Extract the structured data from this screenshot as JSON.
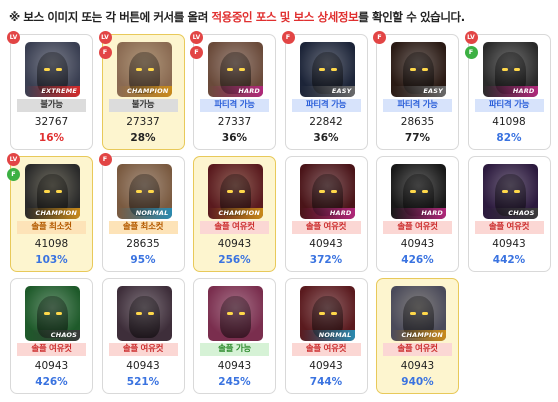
{
  "notice": {
    "prefix": "※ 보스 이미지 또는 각 버튼에 커서를 올려 ",
    "highlight": "적용중인 포스 및 보스 상세정보",
    "suffix": "를 확인할 수 있습니다."
  },
  "colors": {
    "status_gray": "#dcdcdc",
    "status_blue": "#d7e3fb",
    "status_orange": "#fde3b8",
    "status_pink": "#fbd7d4",
    "status_green": "#d6f2d6",
    "highlight_red": "#e03030",
    "card_gold": "#fdf5cf"
  },
  "bosses": [
    {
      "difficulty": "EXTREME",
      "status": "불가능",
      "power": "32767",
      "percent": "16%",
      "badges": [
        "lv"
      ],
      "status_style": "gray",
      "percent_style": "red",
      "highlight": false,
      "theme": "#3a3f52"
    },
    {
      "difficulty": "CHAMPION",
      "status": "불가능",
      "power": "27337",
      "percent": "28%",
      "badges": [
        "lv",
        "f"
      ],
      "status_style": "gray",
      "percent_style": "dark",
      "highlight": true,
      "theme": "#8a6a52"
    },
    {
      "difficulty": "HARD",
      "status": "파티격 가능",
      "power": "27337",
      "percent": "36%",
      "badges": [
        "lv",
        "f"
      ],
      "status_style": "blue",
      "percent_style": "dark",
      "highlight": false,
      "theme": "#6a4a3a"
    },
    {
      "difficulty": "EASY",
      "status": "파티격 가능",
      "power": "22842",
      "percent": "36%",
      "badges": [
        "f"
      ],
      "status_style": "blue",
      "percent_style": "dark",
      "highlight": false,
      "theme": "#1c2438"
    },
    {
      "difficulty": "EASY",
      "status": "파티격 가능",
      "power": "28635",
      "percent": "77%",
      "badges": [
        "f"
      ],
      "status_style": "blue",
      "percent_style": "dark",
      "highlight": false,
      "theme": "#2a1a14"
    },
    {
      "difficulty": "HARD",
      "status": "파티격 가능",
      "power": "41098",
      "percent": "82%",
      "badges": [
        "lv",
        "fg"
      ],
      "status_style": "blue",
      "percent_style": "blue",
      "highlight": false,
      "theme": "#2a2a2a"
    },
    {
      "difficulty": "CHAMPION",
      "status": "솔플 최소컷",
      "power": "41098",
      "percent": "103%",
      "badges": [
        "lv",
        "fg"
      ],
      "status_style": "orange",
      "percent_style": "blue",
      "highlight": true,
      "theme": "#2a2a2a"
    },
    {
      "difficulty": "NORMAL",
      "status": "솔플 최소컷",
      "power": "28635",
      "percent": "95%",
      "badges": [
        "f"
      ],
      "status_style": "orange",
      "percent_style": "blue",
      "highlight": false,
      "theme": "#7a5a40"
    },
    {
      "difficulty": "CHAMPION",
      "status": "솔플 여유컷",
      "power": "40943",
      "percent": "256%",
      "badges": [],
      "status_style": "pink",
      "percent_style": "blue",
      "highlight": true,
      "theme": "#5a1a1e"
    },
    {
      "difficulty": "HARD",
      "status": "솔플 여유컷",
      "power": "40943",
      "percent": "372%",
      "badges": [],
      "status_style": "pink",
      "percent_style": "blue",
      "highlight": false,
      "theme": "#4a1418"
    },
    {
      "difficulty": "HARD",
      "status": "솔플 여유컷",
      "power": "40943",
      "percent": "426%",
      "badges": [],
      "status_style": "pink",
      "percent_style": "blue",
      "highlight": false,
      "theme": "#181818"
    },
    {
      "difficulty": "CHAOS",
      "status": "솔플 여유컷",
      "power": "40943",
      "percent": "442%",
      "badges": [],
      "status_style": "pink",
      "percent_style": "blue",
      "highlight": false,
      "theme": "#2c1a3e"
    },
    {
      "difficulty": "CHAOS",
      "status": "솔플 여유컷",
      "power": "40943",
      "percent": "426%",
      "badges": [],
      "status_style": "pink",
      "percent_style": "blue",
      "highlight": false,
      "theme": "#1e5a2a"
    },
    {
      "difficulty": "",
      "status": "솔플 여유컷",
      "power": "40943",
      "percent": "521%",
      "badges": [],
      "status_style": "pink",
      "percent_style": "blue",
      "highlight": false,
      "theme": "#3e2e3a"
    },
    {
      "difficulty": "",
      "status": "솔플 가능",
      "power": "40943",
      "percent": "245%",
      "badges": [],
      "status_style": "green",
      "percent_style": "blue",
      "highlight": false,
      "theme": "#7a2e4e"
    },
    {
      "difficulty": "NORMAL",
      "status": "솔플 여유컷",
      "power": "40943",
      "percent": "744%",
      "badges": [],
      "status_style": "pink",
      "percent_style": "blue",
      "highlight": false,
      "theme": "#5a1a1e"
    },
    {
      "difficulty": "CHAMPION",
      "status": "솔플 여유컷",
      "power": "40943",
      "percent": "940%",
      "badges": [],
      "status_style": "pink",
      "percent_style": "blue",
      "highlight": true,
      "theme": "#4a4a5a"
    }
  ]
}
